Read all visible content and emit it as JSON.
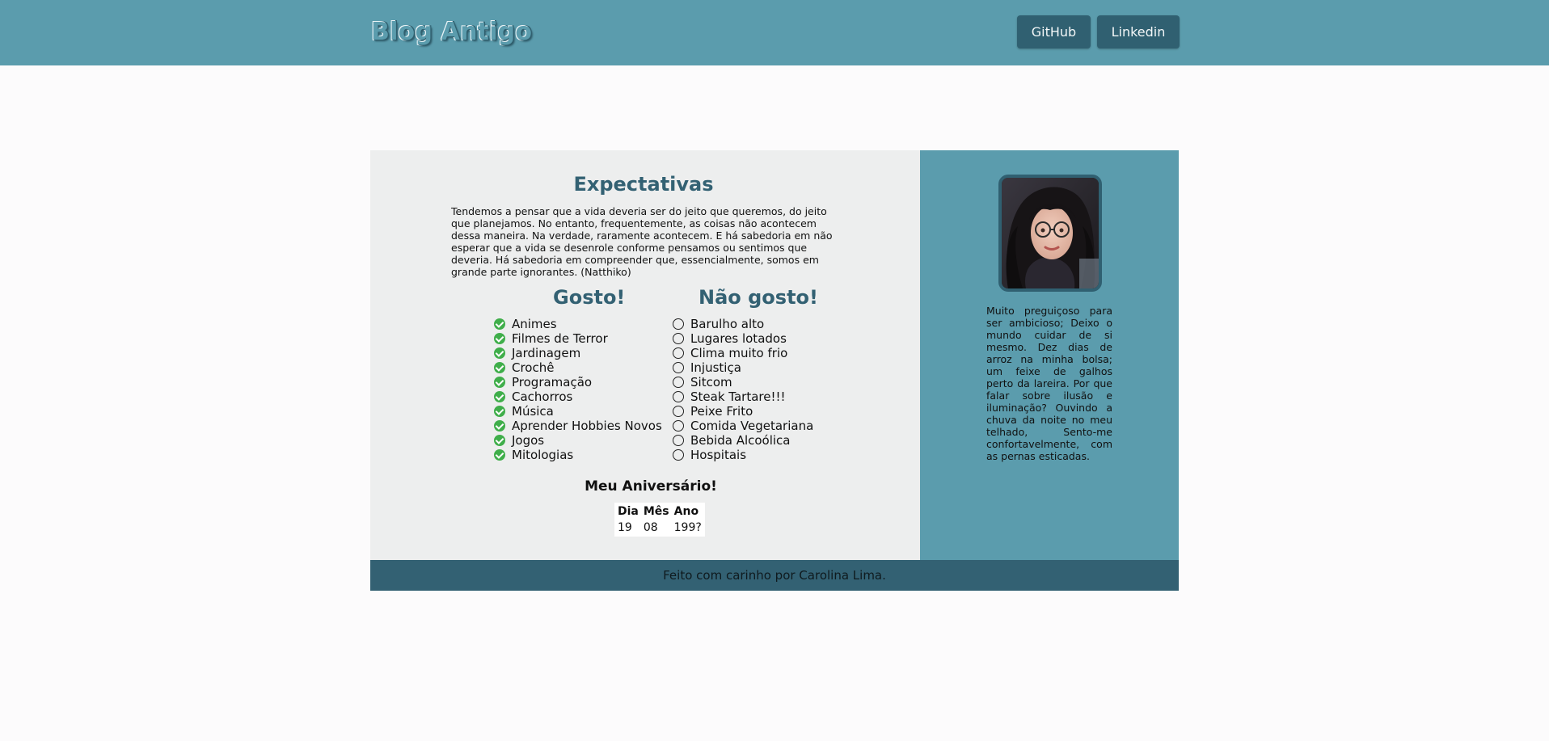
{
  "header": {
    "brand": "Blog Antigo",
    "github_label": "GitHub",
    "linkedin_label": "Linkedin"
  },
  "main": {
    "title": "Expectativas",
    "intro": "Tendemos a pensar que a vida deveria ser do jeito que queremos, do jeito que planejamos. No entanto, frequentemente, as coisas não acontecem dessa maneira. Na verdade, raramente acontecem. E há sabedoria em não esperar que a vida se desenrole conforme pensamos ou sentimos que deveria. Há sabedoria em compreender que, essencialmente, somos em grande parte ignorantes. (Natthiko)",
    "likes_title": "Gosto!",
    "likes": [
      "Animes",
      "Filmes de Terror",
      "Jardinagem",
      "Crochê",
      "Programação",
      "Cachorros",
      "Música",
      "Aprender Hobbies Novos",
      "Jogos",
      "Mitologias"
    ],
    "dislikes_title": "Não gosto!",
    "dislikes": [
      "Barulho alto",
      "Lugares lotados",
      "Clima muito frio",
      "Injustiça",
      "Sitcom",
      "Steak Tartare!!!",
      "Peixe Frito",
      "Comida Vegetariana",
      "Bebida Alcoólica",
      "Hospitais"
    ],
    "birthday": {
      "title": "Meu Aniversário!",
      "headers": [
        "Dia",
        "Mês",
        "Ano"
      ],
      "values": [
        "19",
        "08",
        "199?"
      ]
    }
  },
  "sidebar": {
    "bio": "Muito preguiçoso para ser ambicioso; Deixo o mundo cuidar de si mesmo. Dez dias de arroz na minha bolsa; um feixe de galhos perto da lareira. Por que falar sobre ilusão e iluminação? Ouvindo a chuva da noite no meu telhado, Sento-me confortavelmente, com as pernas esticadas."
  },
  "footer": {
    "text": "Feito com carinho por Carolina Lima."
  },
  "colors": {
    "header_bg": "#5b9cad",
    "button_bg": "#306071",
    "content_bg": "#edeeee",
    "heading": "#336173",
    "check_green": "#3fae4a",
    "footer_bg": "#336173"
  }
}
